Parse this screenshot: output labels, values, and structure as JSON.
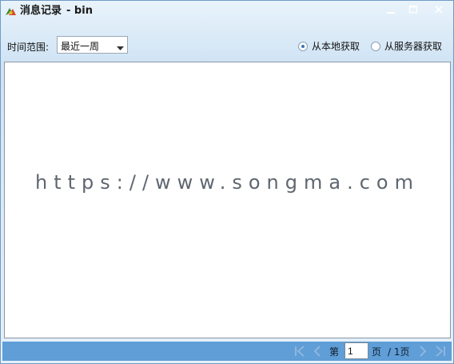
{
  "window": {
    "title": "消息记录",
    "title_suffix": "- bin"
  },
  "toolbar": {
    "range_label": "时间范围:",
    "range_value": "最近一周",
    "radio_local_label": "从本地获取",
    "radio_local_checked": true,
    "radio_server_label": "从服务器获取",
    "radio_server_checked": false
  },
  "content": {
    "watermark": "https://www.songma.com"
  },
  "pager": {
    "prefix": "第",
    "page_value": "1",
    "suffix": "页",
    "total": "/ 1页"
  },
  "icons": {
    "app": "app-logo-icon",
    "minimize": "minimize-icon",
    "maximize": "maximize-icon",
    "close": "close-icon",
    "first": "first-page-icon",
    "prev": "prev-page-icon",
    "next": "next-page-icon",
    "last": "last-page-icon",
    "dropdown": "chevron-down-icon"
  },
  "colors": {
    "pager_bg": "#5f9ed7",
    "radio_accent": "#3f73b3"
  }
}
